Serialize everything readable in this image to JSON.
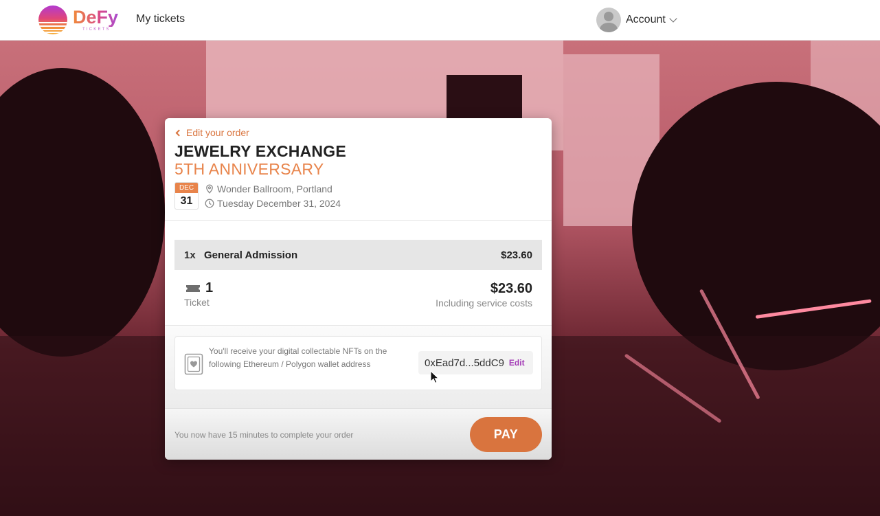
{
  "header": {
    "logo_word": "DeFy",
    "logo_sub": "TICKETS",
    "nav_my_tickets": "My tickets",
    "account_label": "Account"
  },
  "order": {
    "back_label": "Edit your order",
    "event_title": "JEWELRY EXCHANGE",
    "event_subtitle": "5TH ANNIVERSARY",
    "date_month": "DEC",
    "date_day": "31",
    "venue": "Wonder Ballroom, Portland",
    "date_full": "Tuesday December 31, 2024"
  },
  "line_item": {
    "qty": "1x",
    "name": "General Admission",
    "price": "$23.60"
  },
  "summary": {
    "count": "1",
    "count_label": "Ticket",
    "total": "$23.60",
    "total_note": "Including service costs"
  },
  "nft": {
    "message": "You'll receive your digital collectable NFTs on the following Ethereum / Polygon wallet address",
    "wallet_address": "0xEad7d...5ddC9",
    "edit_label": "Edit"
  },
  "footer": {
    "timer_text": "You now have 15 minutes to complete your order",
    "pay_label": "PAY"
  },
  "colors": {
    "accent_orange": "#d9743e",
    "subtitle_orange": "#e8844b",
    "edit_purple": "#a33bb6"
  },
  "icons": [
    "defy-logo-icon",
    "avatar-icon",
    "chevron-down-icon",
    "chevron-left-icon",
    "location-pin-icon",
    "clock-icon",
    "ticket-icon",
    "nft-card-icon",
    "cursor-icon"
  ]
}
